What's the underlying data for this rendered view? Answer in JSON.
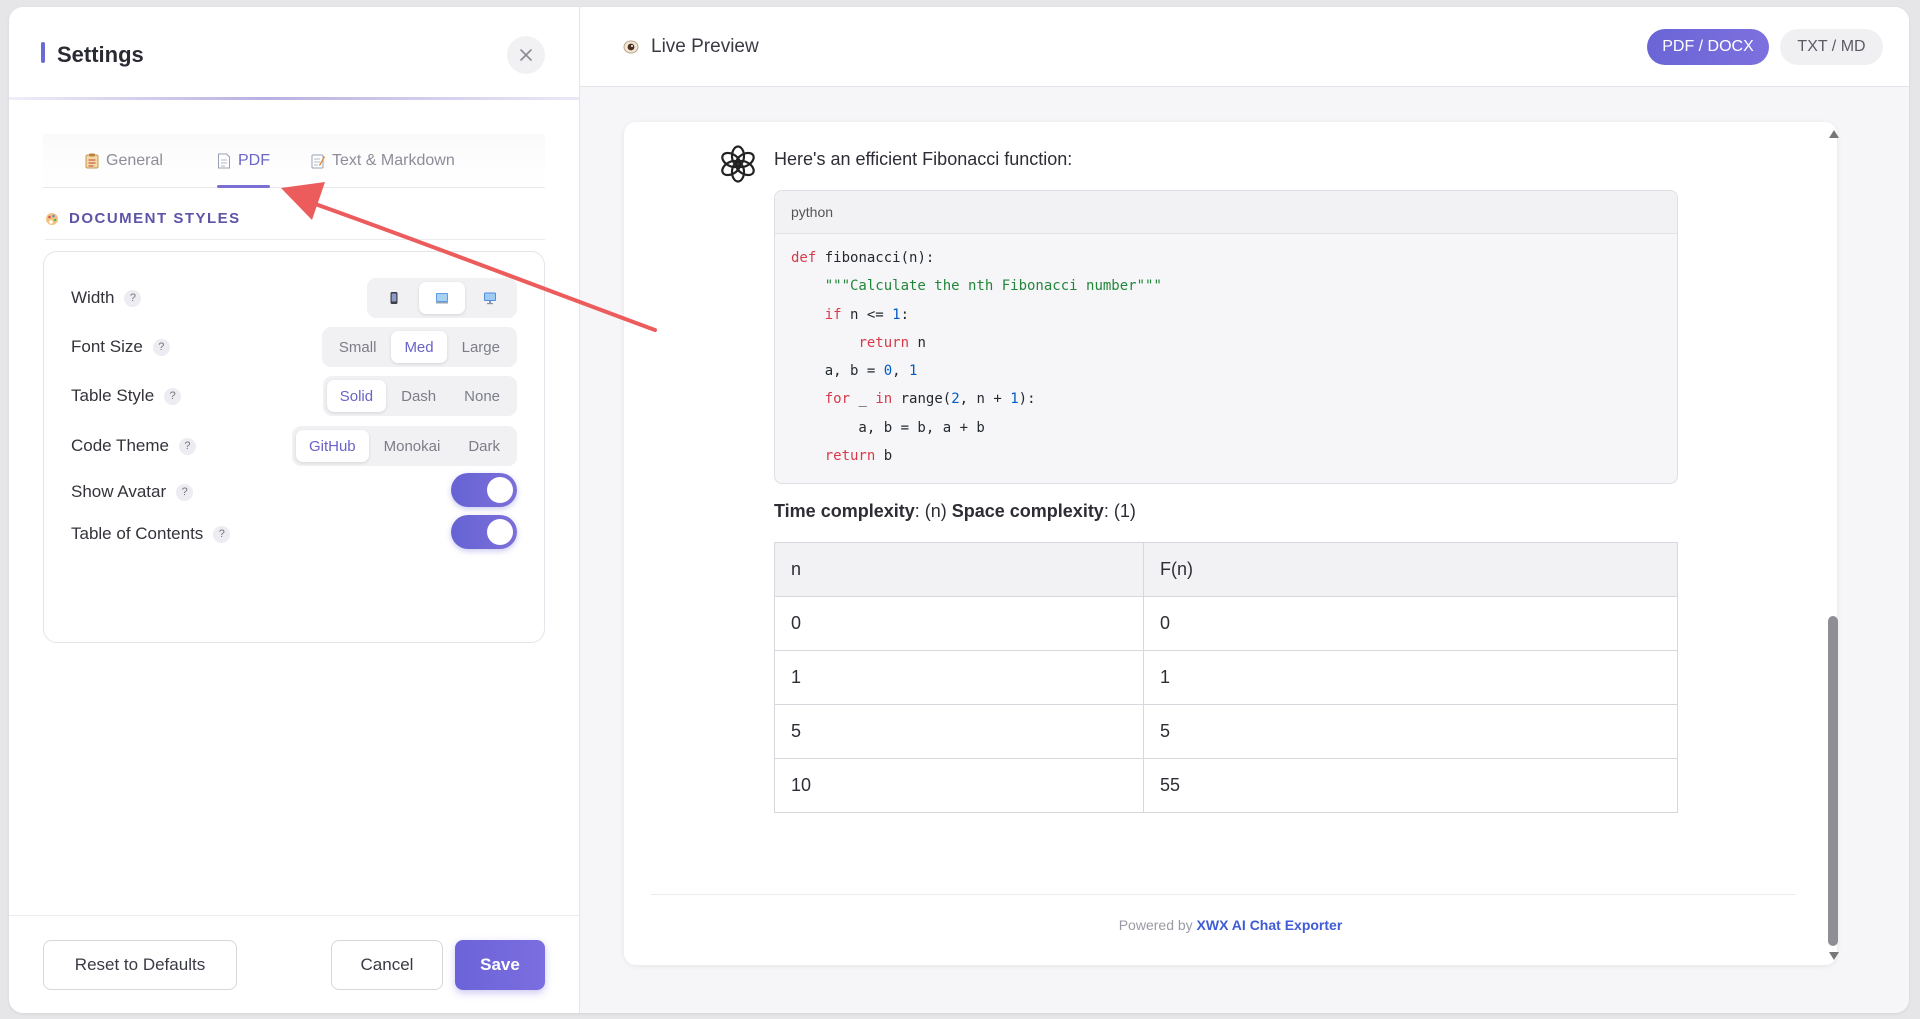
{
  "settings": {
    "title": "Settings",
    "tabs": [
      {
        "label": "General",
        "icon": "clipboard-icon"
      },
      {
        "label": "PDF",
        "icon": "document-icon"
      },
      {
        "label": "Text & Markdown",
        "icon": "memo-icon"
      }
    ],
    "section_title": "DOCUMENT STYLES",
    "rows": {
      "width": {
        "label": "Width",
        "help": "?",
        "options": [
          "mobile-icon",
          "tablet-icon",
          "desktop-icon"
        ],
        "selected": 1
      },
      "font_size": {
        "label": "Font Size",
        "help": "?",
        "options": [
          "Small",
          "Med",
          "Large"
        ],
        "selected": 1
      },
      "table_style": {
        "label": "Table Style",
        "help": "?",
        "options": [
          "Solid",
          "Dash",
          "None"
        ],
        "selected": 0
      },
      "code_theme": {
        "label": "Code Theme",
        "help": "?",
        "options": [
          "GitHub",
          "Monokai",
          "Dark"
        ],
        "selected": 0
      },
      "show_avatar": {
        "label": "Show Avatar",
        "help": "?",
        "on": true
      },
      "toc": {
        "label": "Table of Contents",
        "help": "?",
        "on": true
      }
    },
    "buttons": {
      "reset": "Reset to Defaults",
      "cancel": "Cancel",
      "save": "Save"
    }
  },
  "preview": {
    "title": "Live Preview",
    "formats": {
      "pdf": "PDF / DOCX",
      "txt": "TXT / MD"
    },
    "message": {
      "intro": "Here's an efficient Fibonacci function:",
      "code_lang": "python",
      "code_lines": [
        "def fibonacci(n):",
        "    \"\"\"Calculate the nth Fibonacci number\"\"\"",
        "    if n <= 1:",
        "        return n",
        "    a, b = 0, 1",
        "    for _ in range(2, n + 1):",
        "        a, b = b, a + b",
        "    return b"
      ],
      "complexity": {
        "time_label": "Time complexity",
        "time_value": ": (n) ",
        "space_label": "Space complexity",
        "space_value": ": (1)"
      },
      "table": {
        "headers": [
          "n",
          "F(n)"
        ],
        "rows": [
          [
            "0",
            "0"
          ],
          [
            "1",
            "1"
          ],
          [
            "5",
            "5"
          ],
          [
            "10",
            "55"
          ]
        ]
      }
    },
    "footer": {
      "prefix": "Powered by ",
      "brand": "XWX AI Chat Exporter"
    }
  },
  "colors": {
    "accent": "#6b63d8",
    "annotation_arrow": "#ec5c5c",
    "link": "#3f5bd6"
  }
}
